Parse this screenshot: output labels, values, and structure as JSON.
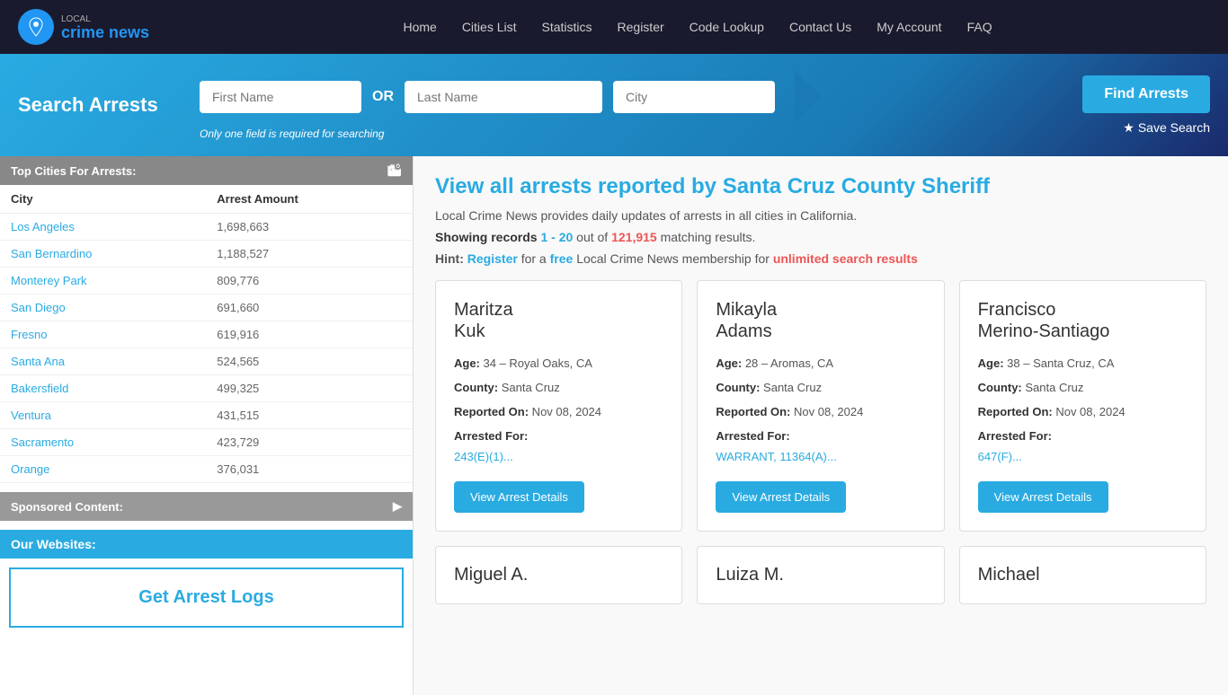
{
  "nav": {
    "links": [
      {
        "label": "Home",
        "id": "home"
      },
      {
        "label": "Cities List",
        "id": "cities-list"
      },
      {
        "label": "Statistics",
        "id": "statistics"
      },
      {
        "label": "Register",
        "id": "register"
      },
      {
        "label": "Code Lookup",
        "id": "code-lookup"
      },
      {
        "label": "Contact Us",
        "id": "contact-us"
      },
      {
        "label": "My Account",
        "id": "my-account"
      },
      {
        "label": "FAQ",
        "id": "faq"
      }
    ],
    "logo_line1": "LOCAL",
    "logo_line2": "crime news"
  },
  "search": {
    "title": "Search Arrests",
    "first_name_placeholder": "First Name",
    "or_label": "OR",
    "last_name_placeholder": "Last Name",
    "city_placeholder": "City",
    "hint": "Only one field is required for searching",
    "find_btn": "Find Arrests",
    "save_search": "Save Search"
  },
  "sidebar": {
    "top_cities_header": "Top Cities For Arrests:",
    "city_col": "City",
    "arrest_col": "Arrest Amount",
    "cities": [
      {
        "name": "Los Angeles",
        "amount": "1,698,663"
      },
      {
        "name": "San Bernardino",
        "amount": "1,188,527"
      },
      {
        "name": "Monterey Park",
        "amount": "809,776"
      },
      {
        "name": "San Diego",
        "amount": "691,660"
      },
      {
        "name": "Fresno",
        "amount": "619,916"
      },
      {
        "name": "Santa Ana",
        "amount": "524,565"
      },
      {
        "name": "Bakersfield",
        "amount": "499,325"
      },
      {
        "name": "Ventura",
        "amount": "431,515"
      },
      {
        "name": "Sacramento",
        "amount": "423,729"
      },
      {
        "name": "Orange",
        "amount": "376,031"
      }
    ],
    "sponsored_label": "Sponsored Content:",
    "our_websites_label": "Our Websites:",
    "get_arrest_logs": "Get Arrest Logs"
  },
  "content": {
    "heading": "View all arrests reported by Santa Cruz County Sheriff",
    "description": "Local Crime News provides daily updates of arrests in all cities in California.",
    "showing_text": "Showing records",
    "range": "1 - 20",
    "out_of": "out of",
    "total": "121,915",
    "matching": "matching results.",
    "hint_prefix": "Hint:",
    "hint_register": "Register",
    "hint_for": "for a",
    "hint_free": "free",
    "hint_middle": "Local Crime News membership for",
    "hint_unlimited": "unlimited search results",
    "arrests": [
      {
        "first_name": "Maritza",
        "last_name": "Kuk",
        "age": "34",
        "location": "Royal Oaks, CA",
        "county": "Santa Cruz",
        "reported": "Nov 08, 2024",
        "arrested_for": "243(E)(1)...",
        "btn": "View Arrest Details"
      },
      {
        "first_name": "Mikayla",
        "last_name": "Adams",
        "age": "28",
        "location": "Aromas, CA",
        "county": "Santa Cruz",
        "reported": "Nov 08, 2024",
        "arrested_for": "WARRANT, 11364(A)...",
        "btn": "View Arrest Details"
      },
      {
        "first_name": "Francisco",
        "last_name": "Merino-Santiago",
        "age": "38",
        "location": "Santa Cruz, CA",
        "county": "Santa Cruz",
        "reported": "Nov 08, 2024",
        "arrested_for": "647(F)...",
        "btn": "View Arrest Details"
      }
    ],
    "bottom_arrests": [
      {
        "first_name": "Miguel A."
      },
      {
        "first_name": "Luiza M."
      },
      {
        "first_name": "Michael"
      }
    ]
  }
}
